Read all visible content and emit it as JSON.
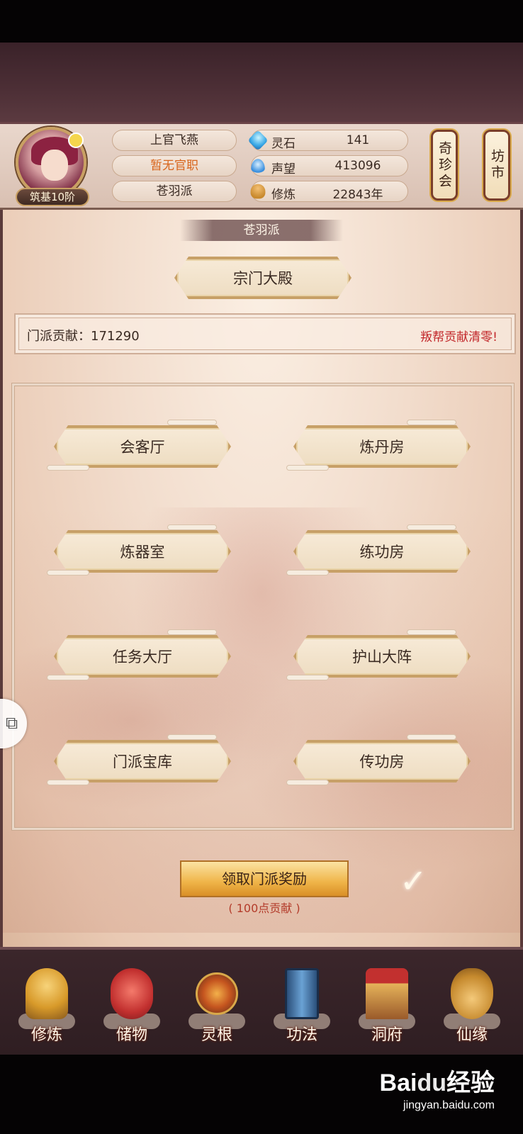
{
  "header": {
    "rank": "筑基10阶",
    "name": "上官飞燕",
    "office": "暂无官职",
    "sect": "苍羽派",
    "stats": [
      {
        "icon": "spirit-stone-icon",
        "label": "灵石",
        "value": "141"
      },
      {
        "icon": "reputation-drop-icon",
        "label": "声望",
        "value": "413096"
      },
      {
        "icon": "cultivation-meditate-icon",
        "label": "修炼",
        "value": "22843年"
      }
    ],
    "side_buttons": [
      "奇珍会",
      "坊市"
    ],
    "office_color": "#d8651c"
  },
  "main": {
    "sect_title": "苍羽派",
    "main_hall": "宗门大殿",
    "contribution_label": "门派贡献：",
    "contribution_value": "171290",
    "warning": "叛帮贡献清零!",
    "warning_color": "#c2272a",
    "buildings": [
      "会客厅",
      "炼丹房",
      "炼器室",
      "练功房",
      "任务大厅",
      "护山大阵",
      "门派宝库",
      "传功房"
    ],
    "reward_button": "领取门派奖励",
    "reward_cost": "( 100点贡献 )"
  },
  "bottom_nav": [
    {
      "label": "修炼",
      "icon": "cultivate-monk-icon"
    },
    {
      "label": "储物",
      "icon": "storage-bag-icon"
    },
    {
      "label": "灵根",
      "icon": "spirit-root-icon"
    },
    {
      "label": "功法",
      "icon": "technique-book-icon"
    },
    {
      "label": "洞府",
      "icon": "cave-house-icon"
    },
    {
      "label": "仙缘",
      "icon": "immortal-gourd-icon"
    }
  ],
  "watermark": {
    "logo": "Bai",
    "logo_paw": "du",
    "logo_suffix": "经验",
    "url": "jingyan.baidu.com"
  }
}
